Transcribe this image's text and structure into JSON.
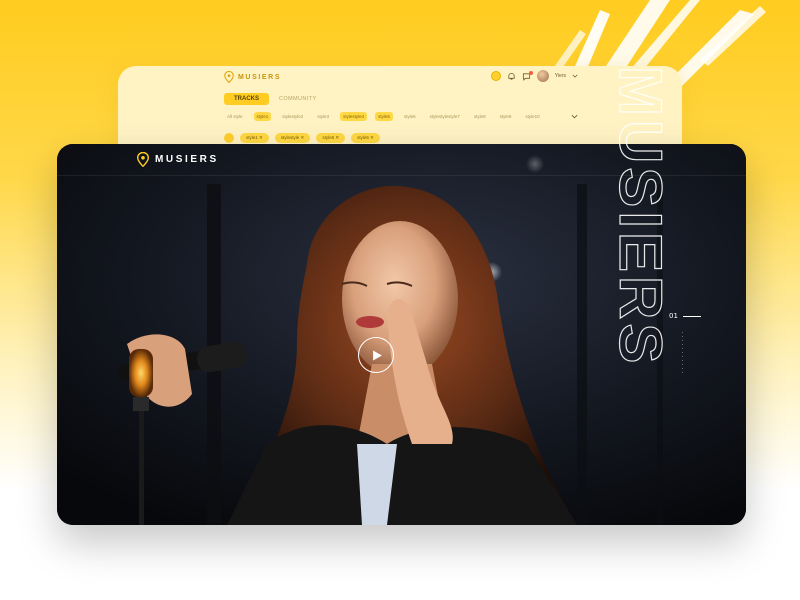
{
  "brand": {
    "name": "MUSIERS",
    "accent": "#ffcc22",
    "background": "#ffcc1f"
  },
  "back_ui": {
    "logo": "MUSIERS",
    "user_name": "Yiers",
    "tabs": [
      {
        "label": "TRACKS",
        "active": true
      },
      {
        "label": "COMMUNITY",
        "active": false
      }
    ],
    "styles": [
      {
        "label": "All style",
        "on": false
      },
      {
        "label": "style1",
        "on": true
      },
      {
        "label": "stylestyle2",
        "on": false
      },
      {
        "label": "style3",
        "on": false
      },
      {
        "label": "stylestyle4",
        "on": true
      },
      {
        "label": "style5",
        "on": true
      },
      {
        "label": "style6",
        "on": false
      },
      {
        "label": "stylestylestyle7",
        "on": false
      },
      {
        "label": "style8",
        "on": false
      },
      {
        "label": "style9",
        "on": false
      },
      {
        "label": "style10",
        "on": false
      }
    ],
    "filters": [
      "style1 ✕",
      "stylestyle ✕",
      "style5 ✕",
      "style6 ✕"
    ],
    "icons": [
      "coin-icon",
      "bell-icon",
      "chat-icon",
      "chevron-down-icon"
    ]
  },
  "hero": {
    "logo": "MUSIERS",
    "vertical_word": "MUSIERS",
    "slide_index": "01",
    "play_icon": "play-icon"
  }
}
